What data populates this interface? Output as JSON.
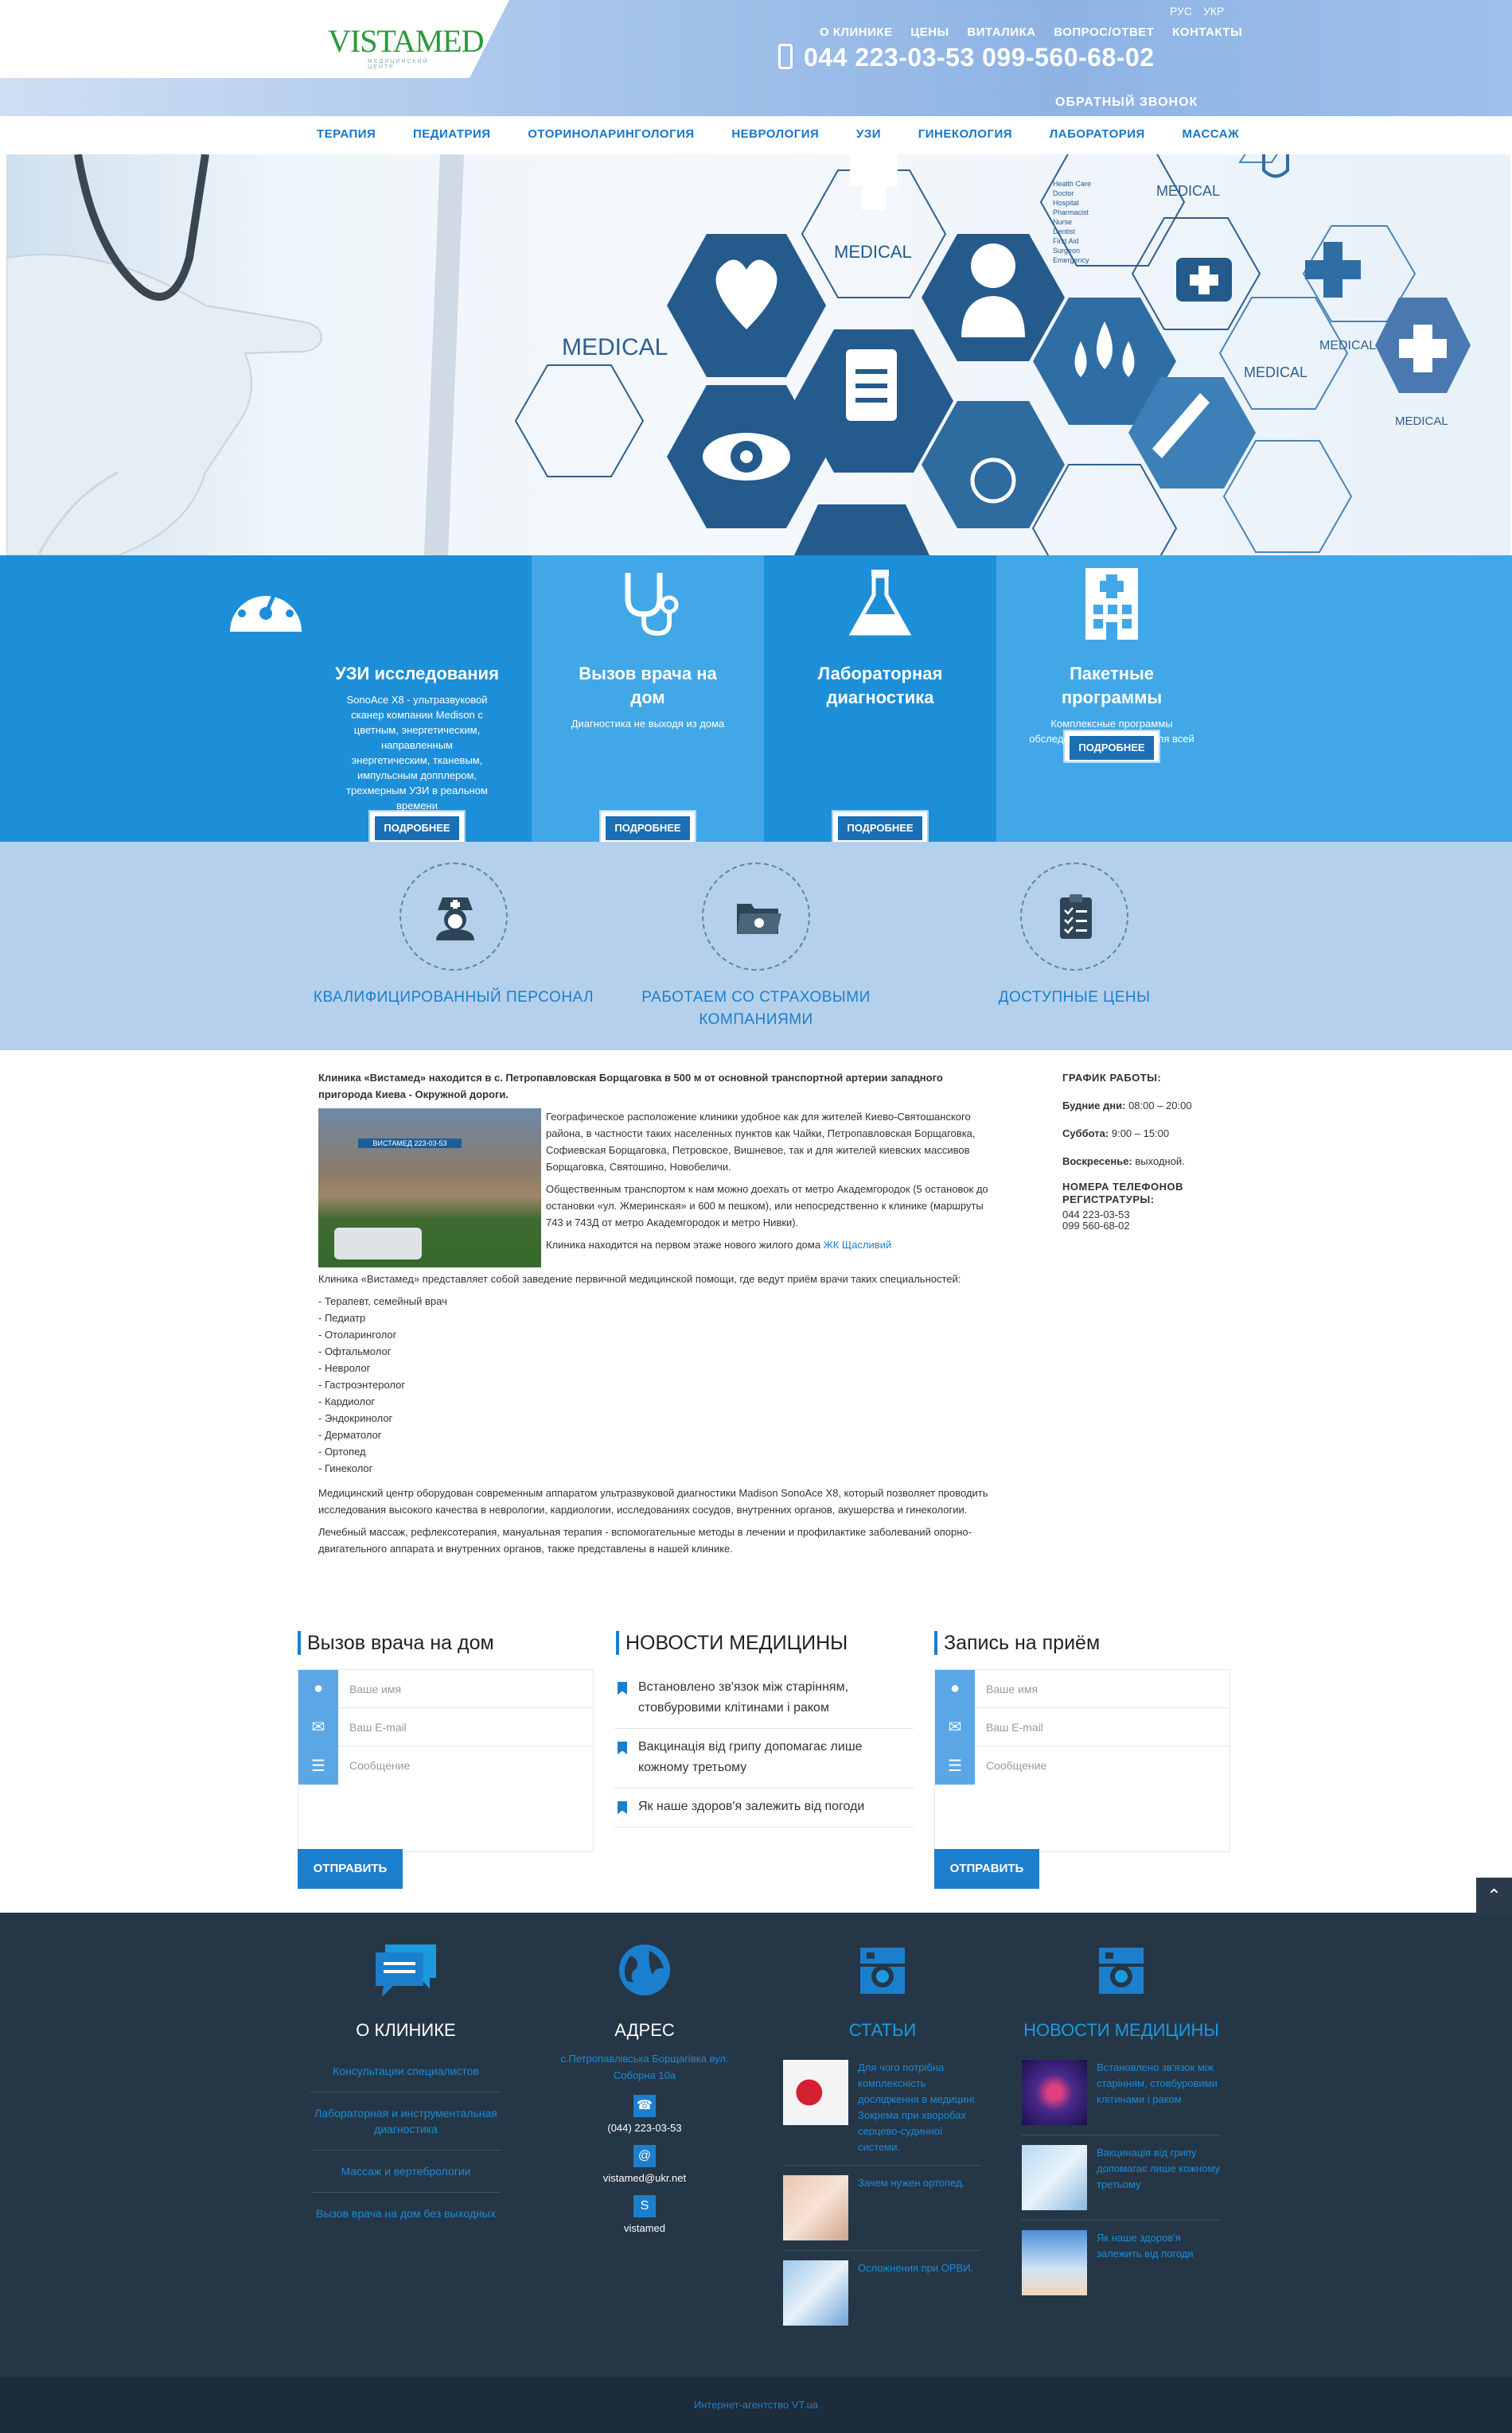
{
  "header": {
    "logo_text": "VISTAMED",
    "logo_sub": "МЕДИЦИНСКИЙ ЦЕНТР",
    "languages": [
      "РУС",
      "УКР"
    ],
    "top_nav": [
      "О КЛИНИКЕ",
      "ЦЕНЫ",
      "ВИТАЛИКА",
      "ВОПРОС/ОТВЕТ",
      "КОНТАКТЫ"
    ],
    "phone": "044 223-03-53 099-560-68-02",
    "callback": "ОБРАТНЫЙ ЗВОНОК"
  },
  "menu": [
    "ТЕРАПИЯ",
    "ПЕДИАТРИЯ",
    "ОТОРИНОЛАРИНГОЛОГИЯ",
    "НЕВРОЛОГИЯ",
    "УЗИ",
    "ГИНЕКОЛОГИЯ",
    "ЛАБОРАТОРИЯ",
    "МАССАЖ"
  ],
  "hero": {
    "labels": [
      "MEDICAL",
      "MEDICAL",
      "MEDICAL",
      "MEDICAL",
      "MEDICAL",
      "MEDICAL"
    ],
    "list": [
      "Health Care",
      "Doctor",
      "Hospital",
      "Pharmacist",
      "Nurse",
      "Dentist",
      "First Aid",
      "Surgeon",
      "Emergency"
    ]
  },
  "tiles": [
    {
      "title": "УЗИ исследования",
      "text": "SonoAce X8 - ультразвуковой сканер компании Medison с цветным, энергетическим, направленным энергетическим, тканевым, импульсным допплером, трехмерным УЗИ в реальном времени",
      "button": "ПОДРОБНЕЕ",
      "color": "#1d8fd8"
    },
    {
      "title": "Вызов врача на дом",
      "text": "Диагностика не выходя из дома",
      "button": "ПОДРОБНЕЕ",
      "color": "#41a7e6"
    },
    {
      "title": "Лабораторная диагностика",
      "text": "",
      "button": "ПОДРОБНЕЕ",
      "color": "#1d8fd8"
    },
    {
      "title": "Пакетные программы",
      "text": "Комплексные программы обследований и лечения для всей семьи",
      "button": "ПОДРОБНЕЕ",
      "color": "#41a7e6"
    }
  ],
  "advantages": [
    "КВАЛИФИЦИРОВАННЫЙ ПЕРСОНАЛ",
    "РАБОТАЕМ СО СТРАХОВЫМИ КОМПАНИЯМИ",
    "ДОСТУПНЫЕ ЦЕНЫ"
  ],
  "content": {
    "lead": "Клиника «Вистамед» находится в с. Петропавловская Борщаговка в 500 м от основной транспортной артерии западного пригорода Киева - Окружной дороги.",
    "photo_sign": "ВИСТАМЕД 223-03-53",
    "p1": "Географическое расположение клиники удобное как для жителей Киево-Святошанского района, в частности таких населенных пунктов как Чайки, Петропавловская Борщаговка, Софиевская Борщаговка, Петровское, Вишневое, так и для жителей киевских массивов Борщаговка, Святошино, Новобеличи.",
    "p2": "Общественным транспортом к нам можно доехать от метро Академгородок (5 остановок до остановки «ул. Жмеринская» и 600 м пешком), или непосредственно к клинике (маршруты 743 и 743Д от метро Академгородок и метро Нивки).",
    "p3_pre": "Клиника находится на первом этаже нового жилого дома ",
    "p3_link": "ЖК Щасливий",
    "p4": "Клиника «Вистамед» представляет собой заведение первичной медицинской помощи, где ведут приём врачи таких специальностей:",
    "specialists": [
      "- Терапевт, семейный врач",
      "- Педиатр",
      "- Отоларинголог",
      "- Офтальмолог",
      "- Невролог",
      "- Гастроэнтеролог",
      "- Кардиолог",
      "- Эндокринолог",
      "- Дерматолог",
      "- Ортопед",
      "- Гинеколог"
    ],
    "p5": "Медицинский центр оборудован современным аппаратом ультразвуковой диагностики Madison SonoAce X8, который позволяет проводить исследования высокого качества в неврологии, кардиологии, исследованиях сосудов, внутренних органов, акушерства и гинекологии.",
    "p6": "Лечебный массаж, рефлексотерапия, мануальная терапия - вспомогательные методы в лечении и профилактике заболеваний опорно- двигательного аппарата и внутренних органов, также представлены в нашей клинике."
  },
  "schedule": {
    "title": "ГРАФИК РАБОТЫ:",
    "weekdays_label": "Будние дни:",
    "weekdays": "08:00 – 20:00",
    "saturday_label": "Суббота:",
    "saturday": "9:00 – 15:00",
    "sunday_label": "Воскресенье:",
    "sunday": "выходной.",
    "phones_title": "НОМЕРА ТЕЛЕФОНОВ РЕГИСТРАТУРЫ:",
    "phone1": "044 223-03-53",
    "phone2": "099 560-68-02"
  },
  "widgets": {
    "call_title": "Вызов врача на дом",
    "news_title": "НОВОСТИ МЕДИЦИНЫ",
    "appointment_title": "Запись на приём",
    "name_placeholder": "Ваше имя",
    "email_placeholder": "Ваш E-mail",
    "message_placeholder": "Сообщение",
    "send": "ОТПРАВИТЬ",
    "news": [
      "Встановлено зв'язок між старінням, стовбуровими клітинами і раком",
      "Вакцинація від грипу допомагає лише кожному третьому",
      "Як наше здоров'я залежить від погоди"
    ]
  },
  "footer": {
    "about_title": "О КЛИНИКЕ",
    "about_links": [
      "Консультации специалистов",
      "Лабораторная и инструментальная диагностика",
      "Массаж и вертебрологии",
      "Вызов врача на дом без выходных"
    ],
    "address_title": "АДРЕС",
    "address": "с.Петропавлівська Борщагівка вул. Соборна 10а",
    "phone": "(044) 223-03-53",
    "email": "vistamed@ukr.net",
    "skype": "vistamed",
    "articles_title": "СТАТЬИ",
    "articles": [
      "Для чого потрібна комплексність дослідження в медицині. Зокрема при хворобах серцево-судинної системи.",
      "Зачем нужен ортопед.",
      "Осложнения при ОРВИ."
    ],
    "news_title": "НОВОСТИ МЕДИЦИНЫ",
    "news": [
      "Встановлено зв'язок між старінням, стовбуровими клітинами і раком",
      "Вакцинація від грипу допомагає лише кожному третьому",
      "Як наше здоров'я залежить від погоди"
    ],
    "bottom": "Интернет-агентство VT.ua"
  },
  "colors": {
    "primary": "#1b7fce",
    "tile_dark": "#1d8fd8",
    "tile_light": "#41a7e6",
    "advantages_bg": "#b5d0ea",
    "footer_bg": "#253747"
  }
}
